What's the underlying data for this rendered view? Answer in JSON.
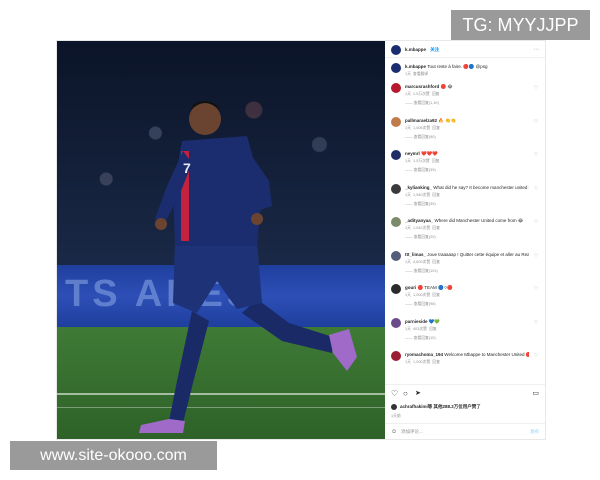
{
  "watermarks": {
    "top": "TG: MYYJJPP",
    "bottom": "www.site-okooo.com"
  },
  "photo": {
    "board_text": "TS  ARES",
    "jersey_number": "7"
  },
  "post": {
    "author": "k.mbappe",
    "follow_label": "关注",
    "caption_user": "k.mbappe",
    "caption_text": "Tout reste à faire. 🔴🔵 @psg",
    "caption_time": "1天",
    "caption_translate": "查看翻译"
  },
  "comments": [
    {
      "user": "marcusrashford",
      "text": "🔴 😂",
      "time": "1天",
      "likes": "1.5万次赞",
      "reply": "回复",
      "replies": "—— 查看回复(1,1K)",
      "avatar": "#b5192b"
    },
    {
      "user": "pallmaraelza92",
      "text": "🔥 👏👏",
      "time": "1天",
      "likes": "1,005次赞",
      "reply": "回复",
      "replies": "—— 查看回复(90)",
      "avatar": "#c17b4a"
    },
    {
      "user": "neymrl",
      "text": "❤️❤️❤️",
      "time": "1天",
      "likes": "1.5万次赞",
      "reply": "回复",
      "replies": "—— 查看回复(39)",
      "avatar": "#1f2f66"
    },
    {
      "user": "_kylianking_",
      "text": "What did he say? It become manchester united in my translation 😂",
      "time": "1天",
      "likes": "1,540次赞",
      "reply": "回复",
      "replies": "—— 查看回复(39)",
      "avatar": "#3a3a3a"
    },
    {
      "user": "_adityanyaa_",
      "text": "Where did Manchester United come from 😂",
      "time": "1天",
      "likes": "1,042次赞",
      "reply": "回复",
      "replies": "—— 查看回复(20)",
      "avatar": "#7a8a6a"
    },
    {
      "user": "ttt_limas_",
      "text": "Joue traaaaap ! Quitter cette équipe et aller au Real Madrid 💙",
      "time": "1天",
      "likes": "4,602次赞",
      "reply": "回复",
      "replies": "—— 查看回复(101)",
      "avatar": "#555e7a"
    },
    {
      "user": "gouri",
      "text": "🔴 TEAM 🔵⚪🔴",
      "time": "1天",
      "likes": "1,000次赞",
      "reply": "回复",
      "replies": "—— 查看回复(98)",
      "avatar": "#2b2b2b"
    },
    {
      "user": "parnieside",
      "text": "💙💚",
      "time": "1天",
      "likes": "403次赞",
      "reply": "回复",
      "replies": "—— 查看回复(10)",
      "avatar": "#6a4c8a"
    },
    {
      "user": "ryomachoma_194",
      "text": "Welcome Mbappe to Manchester United 🔴 #NewEra 🙏🎉",
      "time": "1天",
      "likes": "1,000次赞",
      "reply": "回复",
      "replies": "",
      "avatar": "#9b1b30"
    }
  ],
  "footer": {
    "liked_by": "achrafhakimi等 其他288.2万位用户赞了",
    "time": "1天前",
    "add_comment_placeholder": "添加评论...",
    "post_label": "发布"
  }
}
